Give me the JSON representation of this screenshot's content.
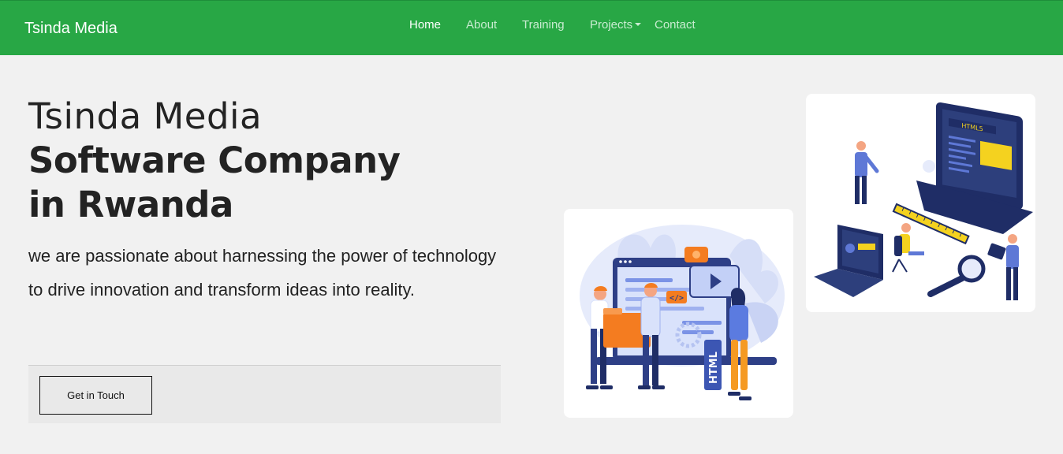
{
  "navbar": {
    "brand": "Tsinda Media",
    "links": [
      {
        "label": "Home",
        "active": true
      },
      {
        "label": "About"
      },
      {
        "label": "Training"
      },
      {
        "label": "Projects",
        "dropdown": true
      },
      {
        "label": "Contact"
      }
    ]
  },
  "hero": {
    "title_line1": "Tsinda Media",
    "title_line2": "Software Company",
    "title_line3": "in Rwanda",
    "tagline": "we are passionate about harnessing the power of technology to drive innovation and transform ideas into reality.",
    "cta_label": "Get in Touch"
  },
  "illustrations": {
    "left": {
      "code_tag": "</>",
      "html_label": "HTML"
    },
    "right": {
      "screen_label": "HTML5"
    }
  },
  "colors": {
    "nav_bg": "#28a745",
    "page_bg": "#f1f1f1",
    "text": "#222222",
    "cta_panel": "#e9e9e9"
  }
}
